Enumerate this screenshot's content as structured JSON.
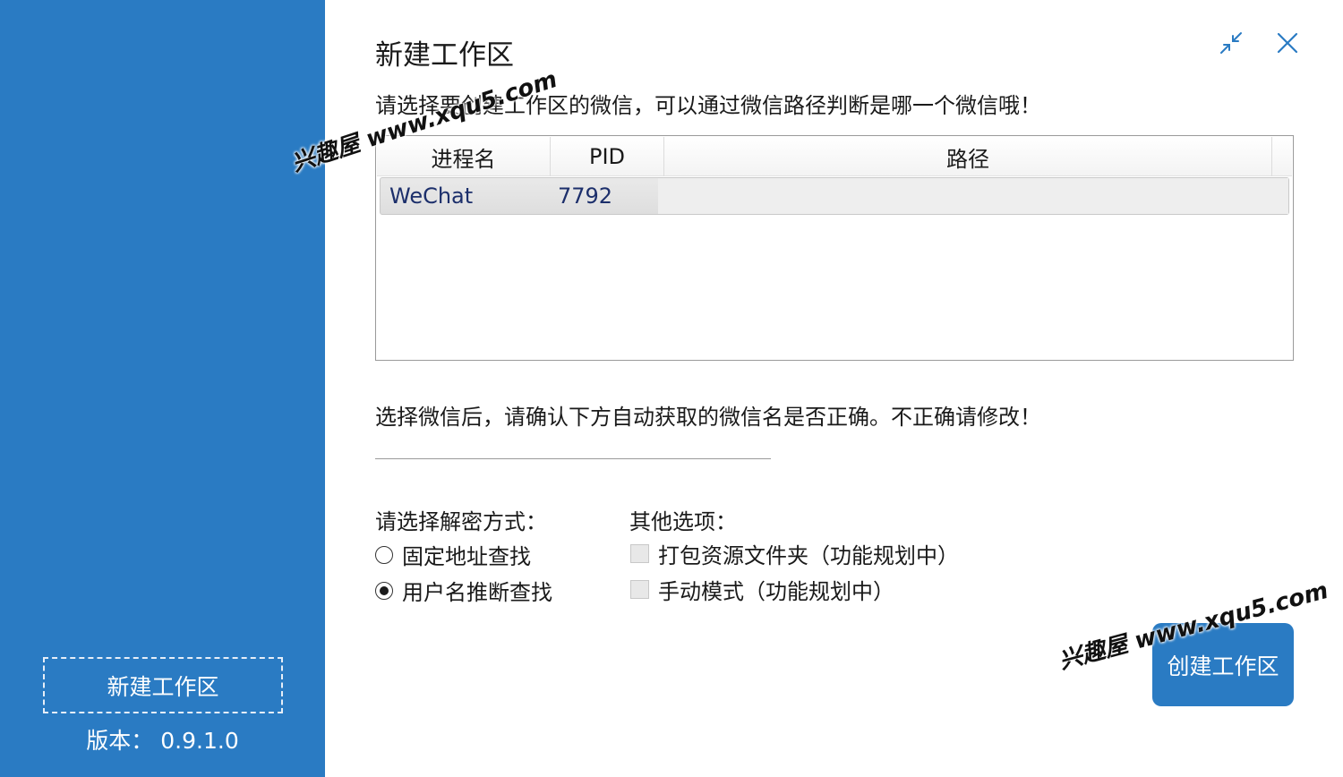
{
  "sidebar": {
    "new_workspace_label": "新建工作区",
    "version_label": "版本：",
    "version_value": "0.9.1.0",
    "color": "#2a7bc3"
  },
  "dialog": {
    "title": "新建工作区",
    "prompt_select_wechat": "请选择要创建工作区的微信，可以通过微信路径判断是哪一个微信哦！",
    "table": {
      "columns": [
        "进程名",
        "PID",
        "路径"
      ],
      "rows": [
        {
          "name": "WeChat",
          "pid": "7792",
          "path": ""
        }
      ]
    },
    "prompt_confirm_name": "选择微信后，请确认下方自动获取的微信名是否正确。不正确请修改！",
    "wechat_name_value": "",
    "decrypt": {
      "label": "请选择解密方式：",
      "options": [
        {
          "label": "固定地址查找",
          "selected": false
        },
        {
          "label": "用户名推断查找",
          "selected": true
        }
      ]
    },
    "other": {
      "label": "其他选项：",
      "options": [
        {
          "label": "打包资源文件夹（功能规划中）",
          "checked": false
        },
        {
          "label": "手动模式（功能规划中）",
          "checked": false
        }
      ]
    },
    "create_button_label": "创建工作区",
    "minimize_icon": "minimize-arrows-icon",
    "close_icon": "close-icon"
  },
  "watermark": {
    "text": "兴趣屋 www.xqu5.com"
  }
}
